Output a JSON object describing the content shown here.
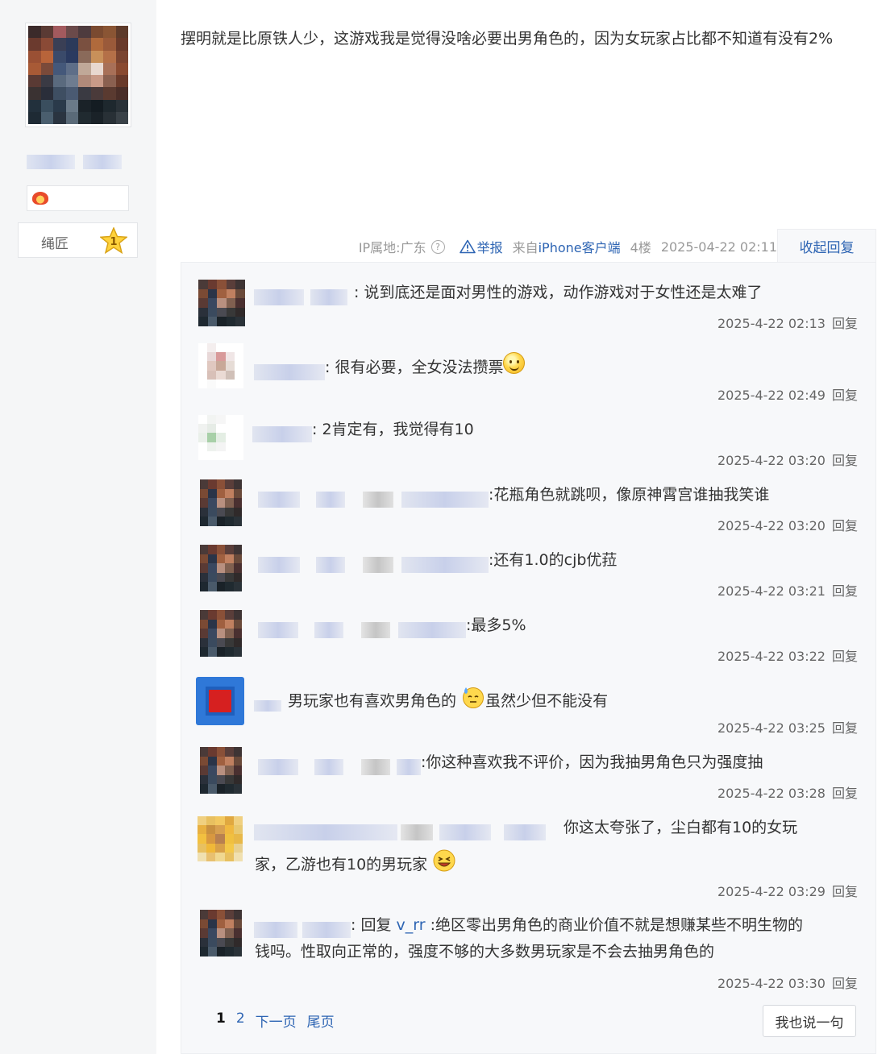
{
  "author": {
    "level_name": "绳匠",
    "level_number": "1"
  },
  "post": {
    "content": "摆明就是比原铁人少，这游戏我是觉得没啥必要出男角色的，因为女玩家占比都不知道有没有2%",
    "ip_location": "IP属地:广东",
    "help_glyph": "?",
    "report_label": "举报",
    "client_prefix": "来自",
    "client_name": "iPhone客户端",
    "floor": "4楼",
    "time": "2025-04-22 02:11",
    "toggle_replies_label": "收起回复"
  },
  "replies": [
    {
      "text": ": 说到底还是面对男性的游戏，动作游戏对于女性还是太难了",
      "time": "2025-4-22 02:13",
      "reply_label": "回复"
    },
    {
      "text": ": 很有必要，全女没法攒票",
      "time": "2025-4-22 02:49",
      "reply_label": "回复",
      "emoji": "smile-emoji"
    },
    {
      "text": ": 2肯定有，我觉得有10",
      "time": "2025-4-22 03:20",
      "reply_label": "回复"
    },
    {
      "text": ":花瓶角色就跳呗，像原神霄宫谁抽我笑谁",
      "time": "2025-4-22 03:20",
      "reply_label": "回复"
    },
    {
      "text": ":还有1.0的cjb优菈",
      "time": "2025-4-22 03:21",
      "reply_label": "回复"
    },
    {
      "text": ":最多5%",
      "time": "2025-4-22 03:22",
      "reply_label": "回复"
    },
    {
      "text_a": "男玩家也有喜欢男角色的",
      "text_b": "虽然少但不能没有",
      "time": "2025-4-22 03:25",
      "reply_label": "回复",
      "emoji": "sweat-emoji"
    },
    {
      "text": ":你这种喜欢我不评价，因为我抽男角色只为强度抽",
      "time": "2025-4-22 03:28",
      "reply_label": "回复"
    },
    {
      "text_a": "你这太夸张了，尘白都有10的女玩",
      "text_b": "家，乙游也有10的男玩家",
      "time": "2025-4-22 03:29",
      "reply_label": "回复",
      "emoji": "laugh-emoji"
    },
    {
      "prefix": ": 回复 ",
      "mention": "v_rr",
      "text_a": " :绝区零出男角色的商业价值不就是想赚某些不明生物的",
      "text_b": "钱吗。性取向正常的，强度不够的大多数男玩家是不会去抽男角色的",
      "time": "2025-4-22 03:30",
      "reply_label": "回复"
    }
  ],
  "pagination": {
    "current": "1",
    "page2": "2",
    "next": "下一页",
    "last": "尾页"
  },
  "say_button_label": "我也说一句",
  "colors": {
    "link": "#2d64b3",
    "reply_bg": "#f7f8fa",
    "sidebar_bg": "#f5f6f7"
  }
}
